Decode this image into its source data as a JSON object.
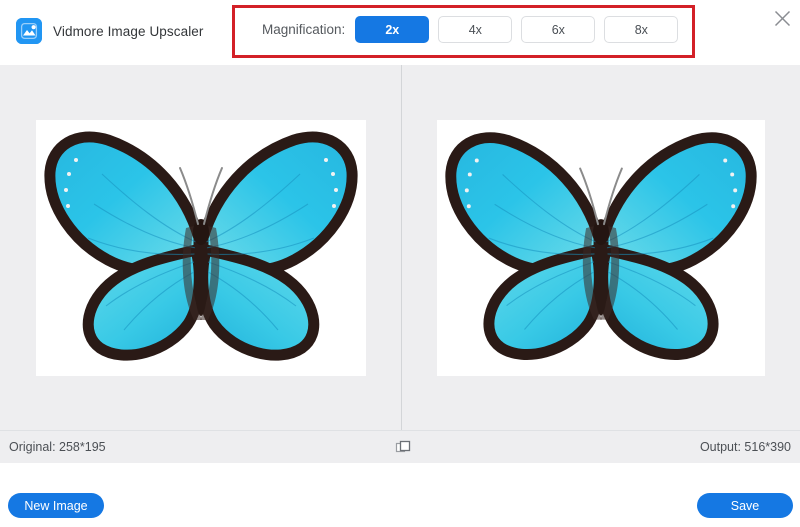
{
  "app": {
    "title": "Vidmore Image Upscaler",
    "logo_icon": "image-logo-icon",
    "close_icon": "close-icon"
  },
  "header": {
    "magnification": {
      "label": "Magnification:",
      "selected": "2x",
      "options": [
        {
          "label": "2x",
          "active": true
        },
        {
          "label": "4x",
          "active": false
        },
        {
          "label": "6x",
          "active": false
        },
        {
          "label": "8x",
          "active": false
        }
      ]
    },
    "annotation": {
      "shape": "rectangle",
      "color": "#d32027"
    }
  },
  "main": {
    "left_pane": {
      "name": "original-image-pane",
      "image": "blue-morpho-butterfly"
    },
    "right_pane": {
      "name": "upscaled-image-pane",
      "image": "blue-morpho-butterfly"
    }
  },
  "statusbar": {
    "original": "Original: 258*195",
    "output": "Output: 516*390",
    "compare_icon": "compare-squares-icon"
  },
  "footer": {
    "new_image_label": "New Image",
    "save_label": "Save"
  },
  "colors": {
    "accent": "#1578e3",
    "annotation": "#d32027",
    "canvas": "#eeeef0"
  }
}
